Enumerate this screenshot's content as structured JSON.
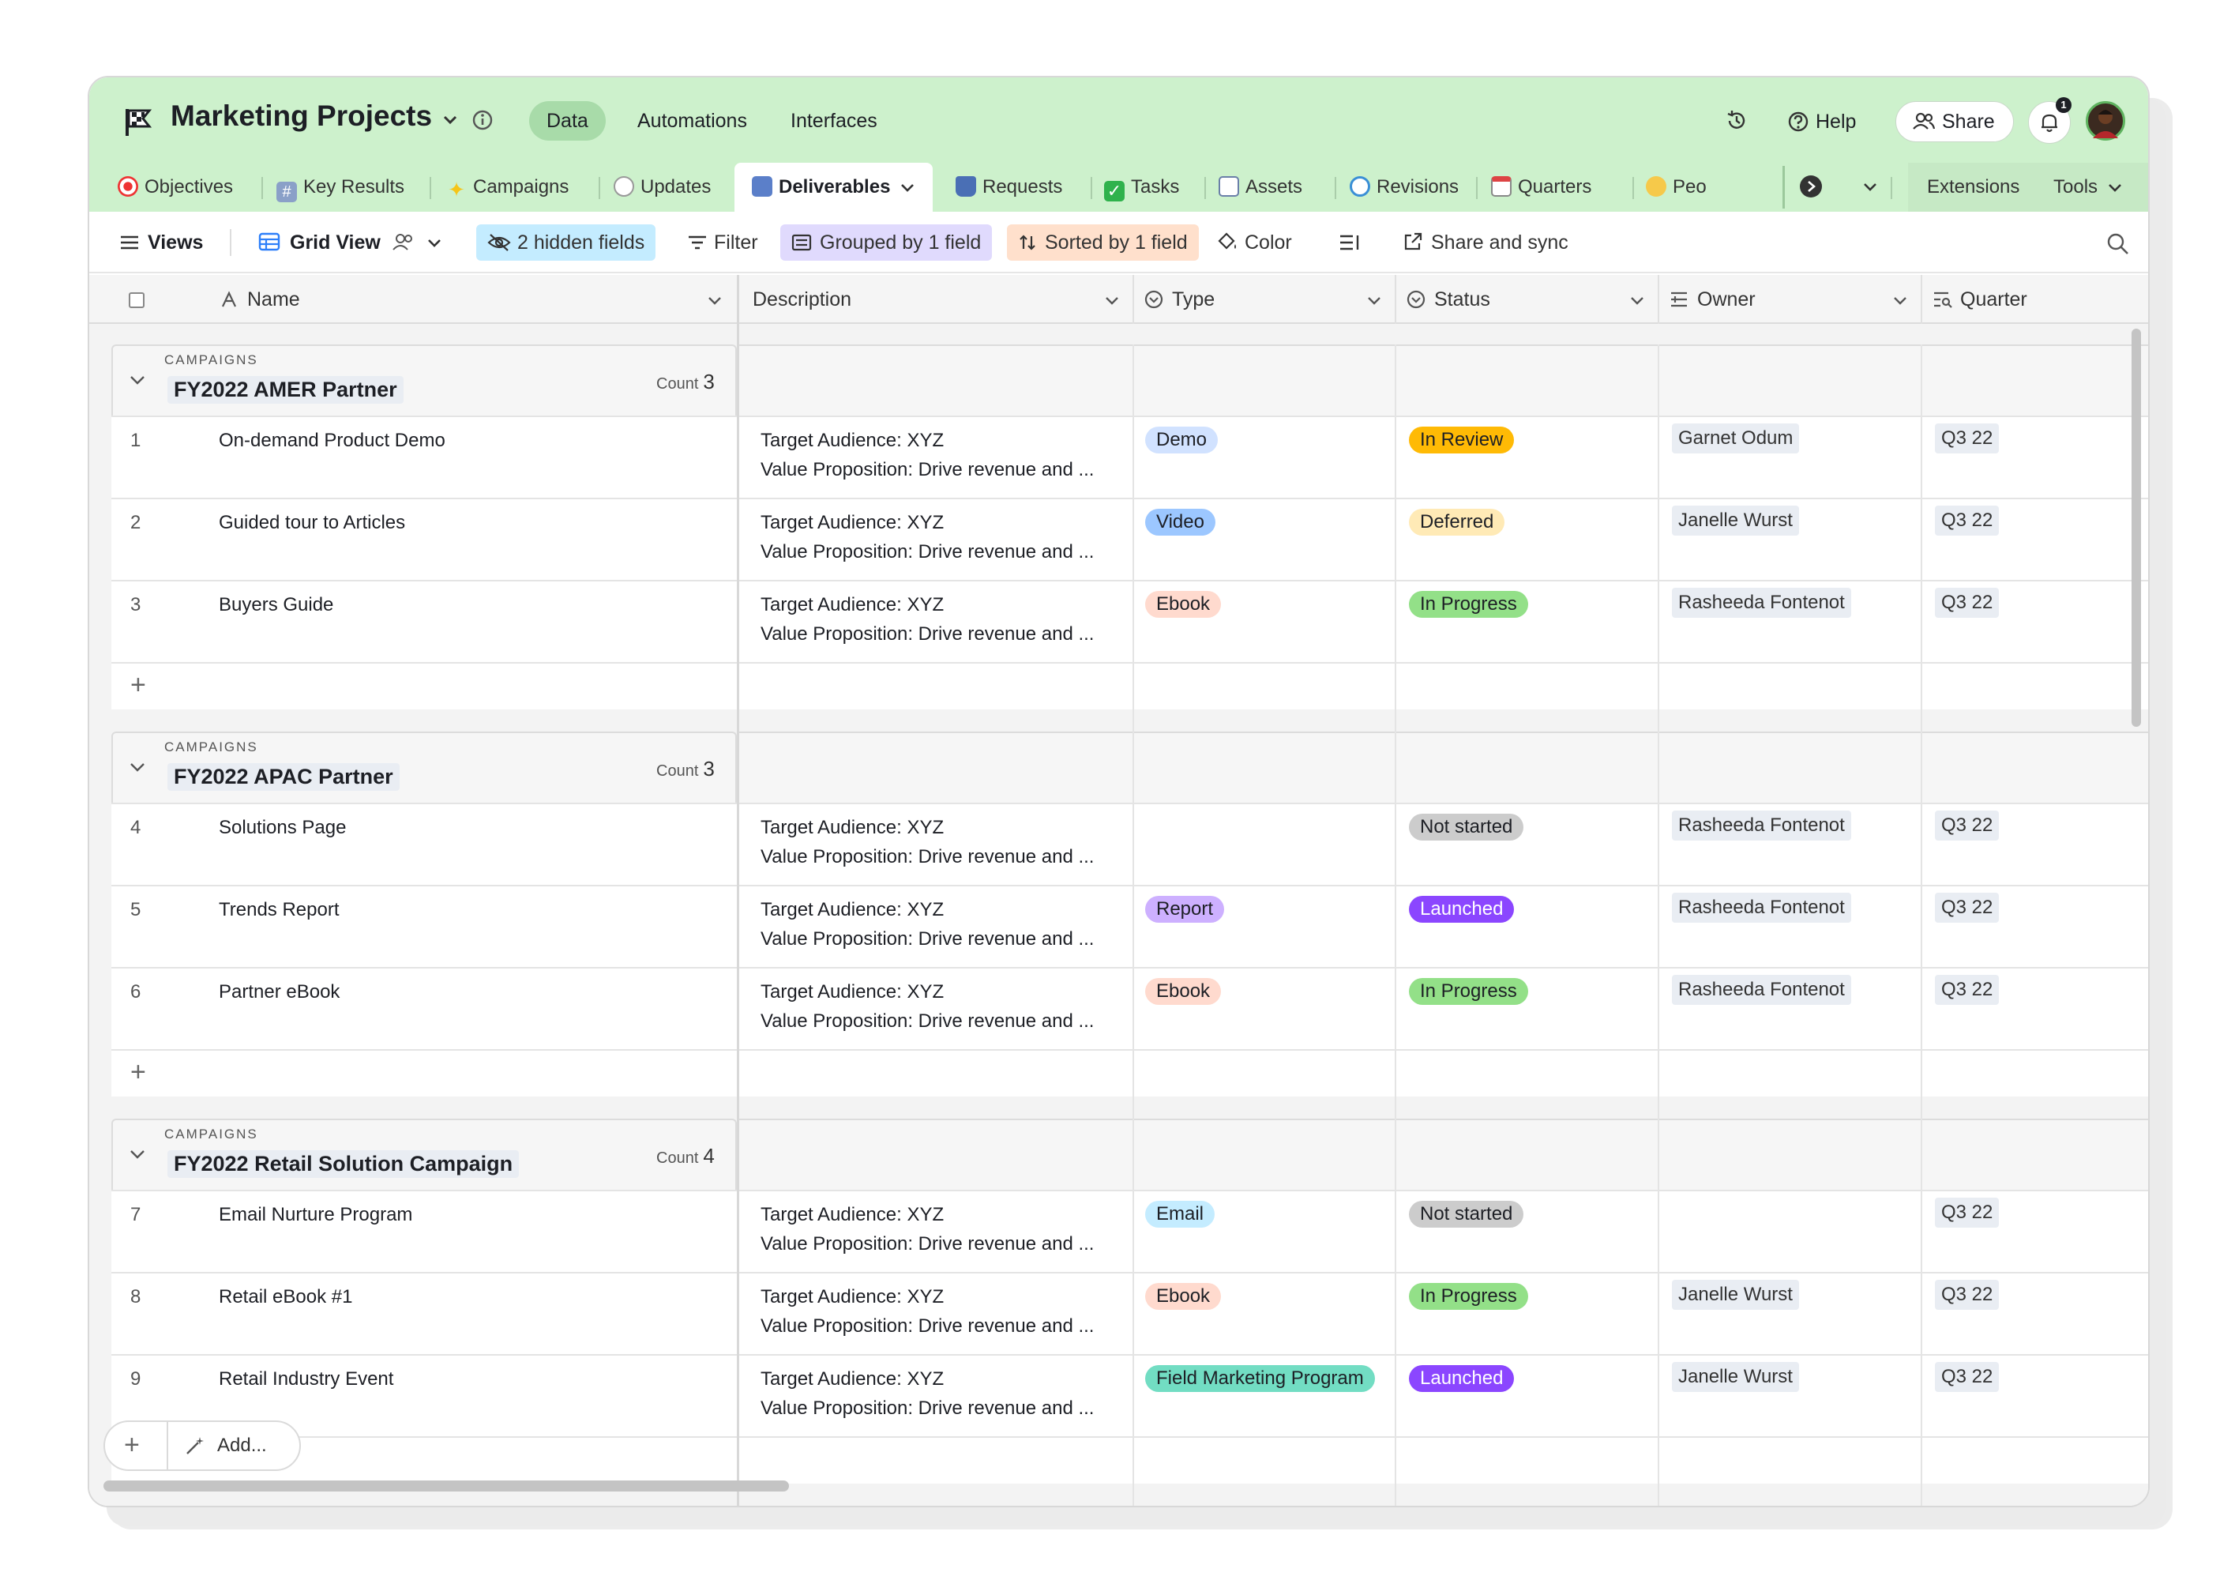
{
  "app": {
    "title": "Marketing Projects",
    "nav": [
      "Data",
      "Automations",
      "Interfaces"
    ],
    "help": "Help",
    "share": "Share",
    "notification_count": "1"
  },
  "tabs": [
    {
      "label": "Objectives",
      "icon": "target-icon"
    },
    {
      "label": "Key Results",
      "icon": "hash-icon"
    },
    {
      "label": "Campaigns",
      "icon": "sparkle-icon"
    },
    {
      "label": "Updates",
      "icon": "speech-bubble-icon"
    },
    {
      "label": "Deliverables",
      "icon": "grid-icon"
    },
    {
      "label": "Requests",
      "icon": "joystick-icon"
    },
    {
      "label": "Tasks",
      "icon": "checkbox-icon"
    },
    {
      "label": "Assets",
      "icon": "book-icon"
    },
    {
      "label": "Revisions",
      "icon": "refresh-icon"
    },
    {
      "label": "Quarters",
      "icon": "calendar-icon"
    },
    {
      "label": "Peo",
      "icon": "raised-hands-icon"
    }
  ],
  "tabbar_right": {
    "extensions": "Extensions",
    "tools": "Tools"
  },
  "toolbar": {
    "views": "Views",
    "grid_view": "Grid View",
    "hidden_fields": "2 hidden fields",
    "filter": "Filter",
    "grouped": "Grouped by 1 field",
    "sorted": "Sorted by 1 field",
    "color": "Color",
    "share_sync": "Share and sync"
  },
  "columns": [
    "Name",
    "Description",
    "Type",
    "Status",
    "Owner",
    "Quarter"
  ],
  "groups": [
    {
      "kicker": "CAMPAIGNS",
      "title": "FY2022 AMER Partner",
      "count_label": "Count",
      "count": "3",
      "rows": [
        {
          "n": "1",
          "name": "On-demand Product Demo",
          "d1": "Target Audience: XYZ",
          "d2": "Value Proposition: Drive revenue and ...",
          "type": "Demo",
          "status": "In Review",
          "owner": "Garnet Odum",
          "quarter": "Q3 22"
        },
        {
          "n": "2",
          "name": "Guided tour to Articles",
          "d1": "Target Audience: XYZ",
          "d2": "Value Proposition: Drive revenue and ...",
          "type": "Video",
          "status": "Deferred",
          "owner": "Janelle Wurst",
          "quarter": "Q3 22"
        },
        {
          "n": "3",
          "name": "Buyers Guide",
          "d1": "Target Audience: XYZ",
          "d2": "Value Proposition: Drive revenue and ...",
          "type": "Ebook",
          "status": "In Progress",
          "owner": "Rasheeda Fontenot",
          "quarter": "Q3 22"
        }
      ]
    },
    {
      "kicker": "CAMPAIGNS",
      "title": "FY2022 APAC Partner",
      "count_label": "Count",
      "count": "3",
      "rows": [
        {
          "n": "4",
          "name": "Solutions Page",
          "d1": "Target Audience: XYZ",
          "d2": "Value Proposition: Drive revenue and ...",
          "type": "",
          "status": "Not started",
          "owner": "Rasheeda Fontenot",
          "quarter": "Q3 22"
        },
        {
          "n": "5",
          "name": "Trends Report",
          "d1": "Target Audience: XYZ",
          "d2": "Value Proposition: Drive revenue and ...",
          "type": "Report",
          "status": "Launched",
          "owner": "Rasheeda Fontenot",
          "quarter": "Q3 22"
        },
        {
          "n": "6",
          "name": "Partner eBook",
          "d1": "Target Audience: XYZ",
          "d2": "Value Proposition: Drive revenue and ...",
          "type": "Ebook",
          "status": "In Progress",
          "owner": "Rasheeda Fontenot",
          "quarter": "Q3 22"
        }
      ]
    },
    {
      "kicker": "CAMPAIGNS",
      "title": "FY2022 Retail Solution Campaign",
      "count_label": "Count",
      "count": "4",
      "rows": [
        {
          "n": "7",
          "name": "Email Nurture Program",
          "d1": "Target Audience: XYZ",
          "d2": "Value Proposition: Drive revenue and ...",
          "type": "Email",
          "status": "Not started",
          "owner": "",
          "quarter": "Q3 22"
        },
        {
          "n": "8",
          "name": "Retail eBook #1",
          "d1": "Target Audience: XYZ",
          "d2": "Value Proposition: Drive revenue and ...",
          "type": "Ebook",
          "status": "In Progress",
          "owner": "Janelle Wurst",
          "quarter": "Q3 22"
        },
        {
          "n": "9",
          "name": "Retail Industry Event",
          "d1": "Target Audience: XYZ",
          "d2": "Value Proposition: Drive revenue and ...",
          "type": "Field Marketing Program",
          "status": "Launched",
          "owner": "Janelle Wurst",
          "quarter": "Q3 22"
        }
      ]
    }
  ],
  "bottom": {
    "add": "Add..."
  },
  "colors": {
    "header_bg": "#cdf1cc",
    "type": {
      "Demo": "#d1e2ff",
      "Video": "#9cc7ff",
      "Ebook": "#ffdace",
      "Report": "#cdb0ff",
      "Email": "#c4ecff",
      "Field Marketing Program": "#72ddc3"
    },
    "status": {
      "In Review": "#ffba05",
      "Deferred": "#ffeab6",
      "In Progress": "#93e088",
      "Not started": "#cccccc",
      "Launched": "#8b46ff"
    }
  }
}
